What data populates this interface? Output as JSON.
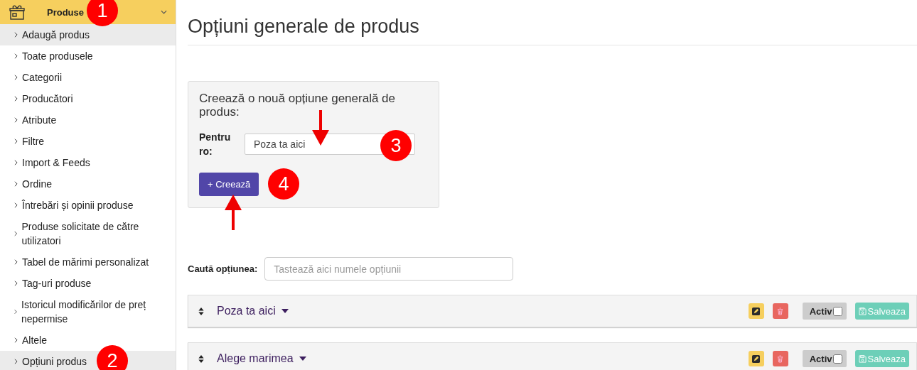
{
  "sidebar": {
    "section": {
      "label": "Produse",
      "expanded": true
    },
    "items": [
      {
        "label": "Adaugă produs",
        "selected": true
      },
      {
        "label": "Toate produsele",
        "selected": false
      },
      {
        "label": "Categorii",
        "selected": false
      },
      {
        "label": "Producători",
        "selected": false
      },
      {
        "label": "Atribute",
        "selected": false
      },
      {
        "label": "Filtre",
        "selected": false
      },
      {
        "label": "Import & Feeds",
        "selected": false
      },
      {
        "label": "Ordine",
        "selected": false
      },
      {
        "label": "Întrebări și opinii produse",
        "selected": false
      },
      {
        "label": "Produse solicitate de către utilizatori",
        "selected": false
      },
      {
        "label": "Tabel de mărimi personalizat",
        "selected": false
      },
      {
        "label": "Tag-uri produse",
        "selected": false
      },
      {
        "label": "Istoricul modificărilor de preț nepermise",
        "selected": false
      },
      {
        "label": "Altele",
        "selected": false
      },
      {
        "label": "Opțiuni produs",
        "selected": true
      }
    ]
  },
  "page_title": "Opțiuni generale de produs",
  "create_card": {
    "heading": "Creează o nouă opțiune generală de produs:",
    "field_label": "Pentru ro:",
    "value": "Poza ta aici",
    "button": "+ Creează"
  },
  "search": {
    "label": "Caută opțiunea:",
    "placeholder": "Tastează aici numele opțiunii"
  },
  "options": [
    {
      "name": "Poza ta aici",
      "active_label": "Activ",
      "active": false,
      "save": "Salveaza"
    },
    {
      "name": "Alege marimea",
      "active_label": "Activ",
      "active": false,
      "save": "Salveaza"
    }
  ],
  "annotations": [
    "1",
    "2",
    "3",
    "4"
  ]
}
